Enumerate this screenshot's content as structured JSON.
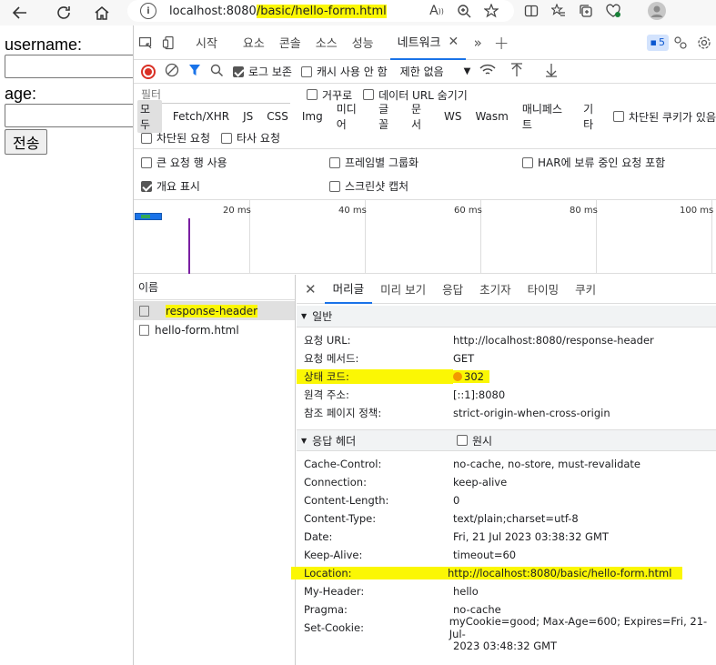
{
  "browser": {
    "address_host": "localhost:8080",
    "address_path": "/basic/hello-form.html",
    "info_icon": "info-icon"
  },
  "page": {
    "username_label": "username:",
    "age_label": "age:",
    "submit_label": "전송"
  },
  "devtools": {
    "tabs": [
      "시작",
      "요소",
      "콘솔",
      "소스",
      "성능",
      "네트워크"
    ],
    "active_tab": "네트워크",
    "issues_count": "5",
    "toolbar": {
      "preserve_log": "로그 보존",
      "disable_cache": "캐시 사용 안 함",
      "throttle": "제한 없음"
    },
    "filter": {
      "placeholder": "필터",
      "invert": "거꾸로",
      "hide_data_url": "데이터 URL 숨기기"
    },
    "types": [
      "모두",
      "Fetch/XHR",
      "JS",
      "CSS",
      "Img",
      "미디어",
      "글꼴",
      "문서",
      "WS",
      "Wasm",
      "매니페스트",
      "기타"
    ],
    "blocked_cookies": "차단된 쿠키가 있음",
    "blocked_requests": "차단된 요청",
    "third_party": "타사 요청",
    "options": {
      "big_rows": "큰 요청 행 사용",
      "group_by_frame": "프레임별 그룹화",
      "har_keep": "HAR에 보류 중인 요청 포함",
      "overview": "개요 표시",
      "screenshots": "스크린샷 캡처"
    },
    "timeline_labels": [
      "20 ms",
      "40 ms",
      "60 ms",
      "80 ms",
      "100 ms"
    ],
    "names_header": "이름",
    "requests": [
      "response-header",
      "hello-form.html"
    ],
    "detail_tabs": [
      "머리글",
      "미리 보기",
      "응답",
      "초기자",
      "타이밍",
      "쿠키"
    ],
    "general": {
      "title": "일반",
      "rows": [
        {
          "k": "요청 URL:",
          "v": "http://localhost:8080/response-header"
        },
        {
          "k": "요청 메서드:",
          "v": "GET"
        },
        {
          "k": "상태 코드:",
          "v": "302"
        },
        {
          "k": "원격 주소:",
          "v": "[::1]:8080"
        },
        {
          "k": "참조 페이지 정책:",
          "v": "strict-origin-when-cross-origin"
        }
      ]
    },
    "response_headers": {
      "title": "응답 헤더",
      "raw_label": "원시",
      "rows": [
        {
          "k": "Cache-Control:",
          "v": "no-cache, no-store, must-revalidate"
        },
        {
          "k": "Connection:",
          "v": "keep-alive"
        },
        {
          "k": "Content-Length:",
          "v": "0"
        },
        {
          "k": "Content-Type:",
          "v": "text/plain;charset=utf-8"
        },
        {
          "k": "Date:",
          "v": "Fri, 21 Jul 2023 03:38:32 GMT"
        },
        {
          "k": "Keep-Alive:",
          "v": "timeout=60"
        },
        {
          "k": "Location:",
          "v": "http://localhost:8080/basic/hello-form.html"
        },
        {
          "k": "My-Header:",
          "v": "hello"
        },
        {
          "k": "Pragma:",
          "v": "no-cache"
        },
        {
          "k": "Set-Cookie:",
          "v": "myCookie=good; Max-Age=600; Expires=Fri, 21-Jul-"
        },
        {
          "k": "",
          "v": "2023 03:48:32 GMT"
        }
      ]
    },
    "highlight_color": "#fbf704",
    "status_color": "#f29900"
  }
}
